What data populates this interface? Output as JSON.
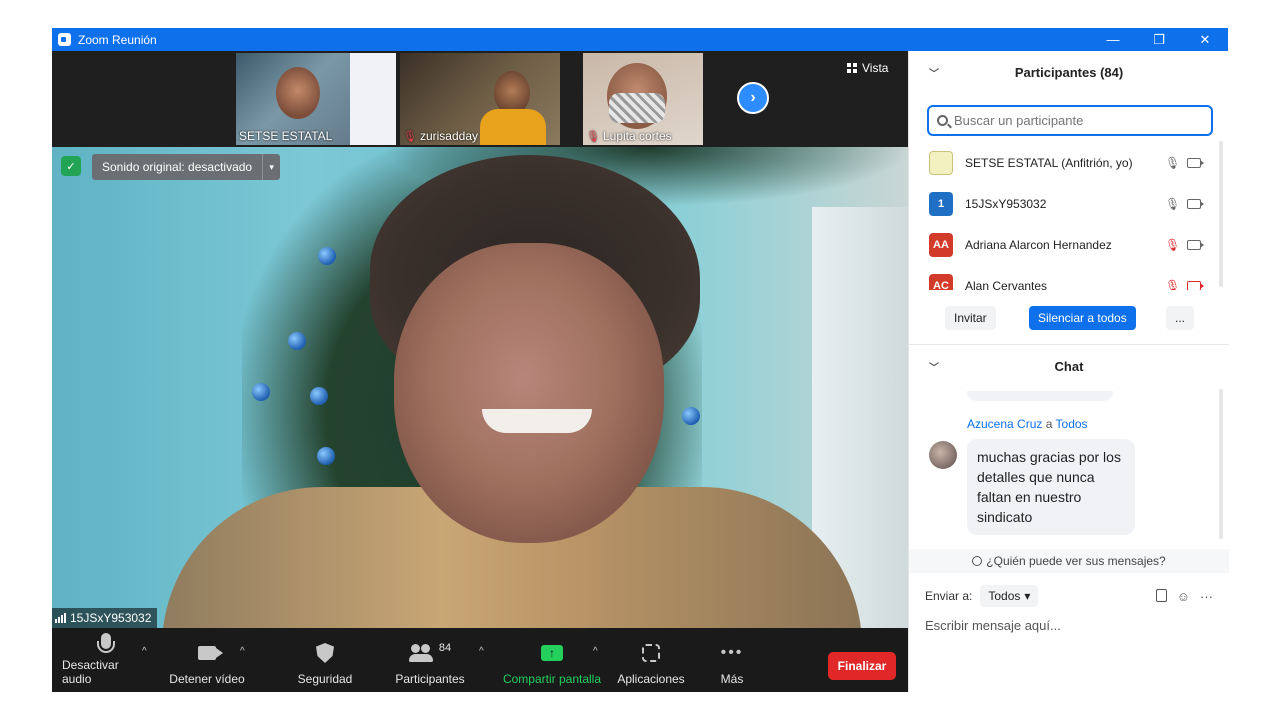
{
  "window": {
    "title": "Zoom Reunión",
    "controls": [
      "—",
      "❐",
      "✕"
    ]
  },
  "top_strip": {
    "thumbnails": [
      {
        "name": "SETSE ESTATAL",
        "muted": false
      },
      {
        "name": "zurisadday",
        "muted": true
      },
      {
        "name": "Lupita cortes",
        "muted": true
      }
    ],
    "view_label": "Vista"
  },
  "main_video": {
    "sound_label": "Sonido original: desactivado",
    "speaker_name": "15JSxY953032"
  },
  "toolbar": {
    "mute_audio": "Desactivar audio",
    "stop_video": "Detener vídeo",
    "security": "Seguridad",
    "participants": "Participantes",
    "participants_count": "84",
    "share_screen": "Compartir pantalla",
    "apps": "Aplicaciones",
    "more": "Más",
    "end": "Finalizar"
  },
  "participants_panel": {
    "title": "Participantes (84)",
    "search_placeholder": "Buscar un participante",
    "participants": [
      {
        "name": "SETSE ESTATAL (Anfitrión, yo)",
        "avatar": "",
        "avatar_color": "#f4f1c0",
        "muted": false,
        "video_off": false
      },
      {
        "name": "15JSxY953032",
        "avatar": "1",
        "avatar_color": "#1f6fc4",
        "muted": false,
        "video_off": false
      },
      {
        "name": "Adriana Alarcon Hernandez",
        "avatar": "AA",
        "avatar_color": "#d23b2a",
        "muted": true,
        "video_off": false
      },
      {
        "name": "Alan Cervantes",
        "avatar": "AC",
        "avatar_color": "#d23b2a",
        "muted": true,
        "video_off": true
      }
    ],
    "invite_label": "Invitar",
    "mute_all_label": "Silenciar a todos",
    "more_label": "..."
  },
  "chat_panel": {
    "title": "Chat",
    "message": {
      "sender": "Azucena Cruz",
      "to_word": "a",
      "recipient": "Todos",
      "text": "muchas gracias por los detalles que nunca faltan en nuestro sindicato"
    },
    "who_can_see": "¿Quién puede ver sus mensajes?",
    "send_to_label": "Enviar a:",
    "send_to_value": "Todos",
    "input_placeholder": "Escribir mensaje aquí..."
  },
  "colors": {
    "zoom_blue": "#0e71eb",
    "end_red": "#e02828",
    "share_green": "#23d05c"
  }
}
